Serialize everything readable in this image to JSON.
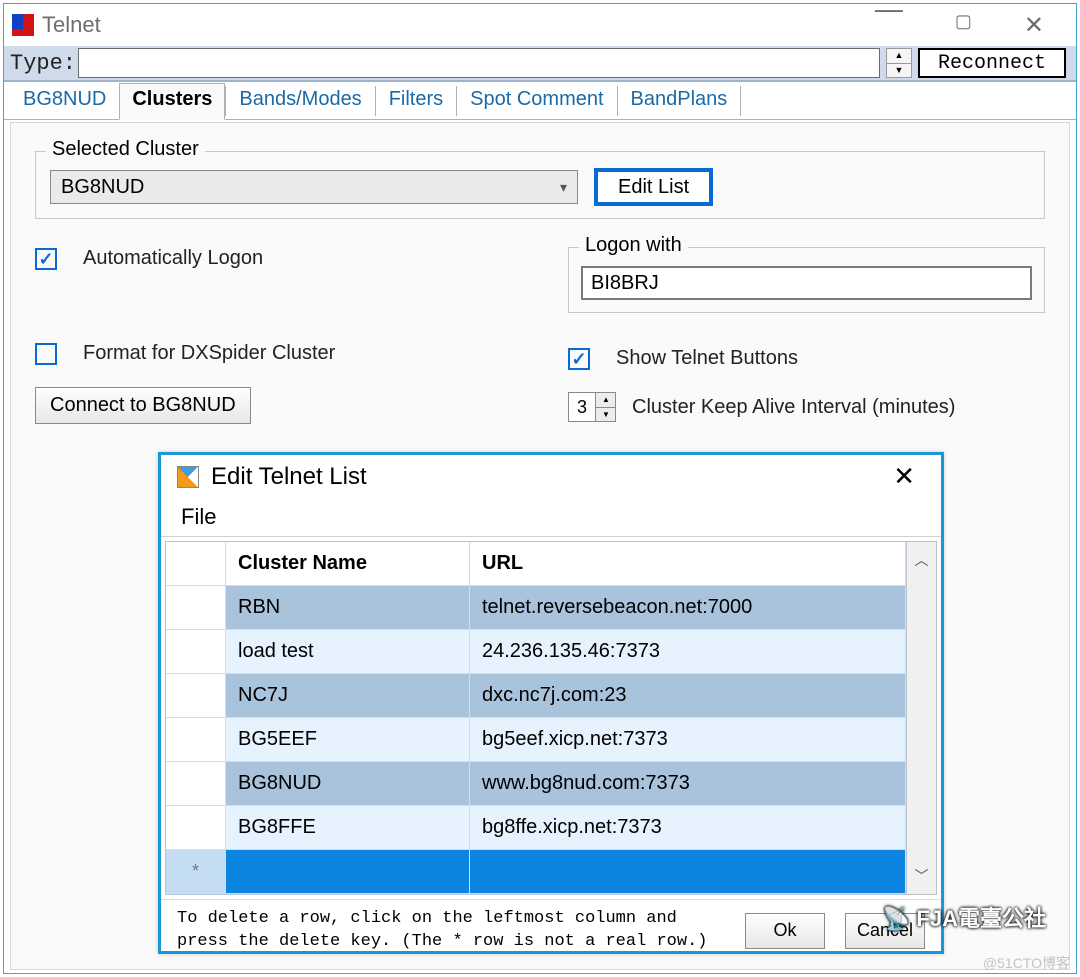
{
  "window": {
    "title": "Telnet",
    "type_label": "Type:",
    "reconnect": "Reconnect"
  },
  "tabs": {
    "items": [
      "BG8NUD",
      "Clusters",
      "Bands/Modes",
      "Filters",
      "Spot Comment",
      "BandPlans"
    ],
    "active": "Clusters"
  },
  "clusters": {
    "group_legend": "Selected Cluster",
    "selected": "BG8NUD",
    "edit_list": "Edit List",
    "auto_logon_label": "Automatically Logon",
    "auto_logon_checked": true,
    "logon_legend": "Logon with",
    "logon_value": "BI8BRJ",
    "format_dxspider_label": "Format for DXSpider Cluster",
    "format_dxspider_checked": false,
    "show_buttons_label": "Show Telnet Buttons",
    "show_buttons_checked": true,
    "connect_label": "Connect to BG8NUD",
    "keepalive_value": "3",
    "keepalive_label": "Cluster Keep Alive Interval (minutes)"
  },
  "modal": {
    "title": "Edit Telnet List",
    "menu_file": "File",
    "headers": {
      "name": "Cluster Name",
      "url": "URL"
    },
    "rows": [
      {
        "name": "RBN",
        "url": "telnet.reversebeacon.net:7000"
      },
      {
        "name": "load test",
        "url": "24.236.135.46:7373"
      },
      {
        "name": "NC7J",
        "url": "dxc.nc7j.com:23"
      },
      {
        "name": "BG5EEF",
        "url": "bg5eef.xicp.net:7373"
      },
      {
        "name": "BG8NUD",
        "url": "www.bg8nud.com:7373"
      },
      {
        "name": "BG8FFE",
        "url": "bg8ffe.xicp.net:7373"
      }
    ],
    "new_row_marker": "*",
    "hint": "To delete a row, click on the leftmost column and\npress the delete key.  (The * row is not a real row.)",
    "ok": "Ok",
    "cancel": "Cancel"
  },
  "watermarks": {
    "brand": "📡 FJA電臺公社",
    "credit": "@51CTO博客"
  }
}
